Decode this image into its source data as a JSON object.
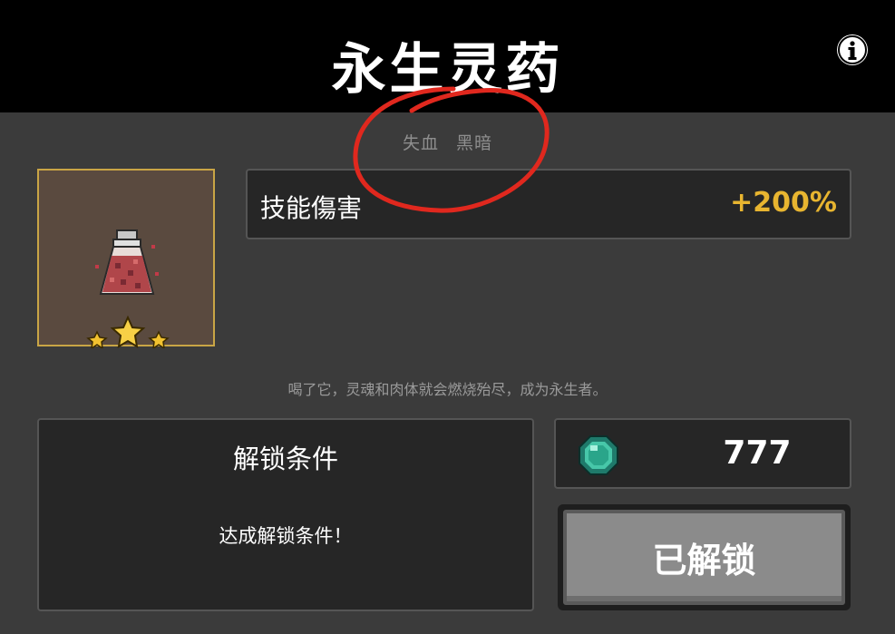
{
  "header": {
    "title": "永生灵药"
  },
  "tags": [
    "失血",
    "黑暗"
  ],
  "item": {
    "icon": "potion-bottle-icon",
    "stars": 3,
    "frame_color": "#c9a545"
  },
  "stat": {
    "name": "技能傷害",
    "value": "+200%",
    "value_color": "#e8b530"
  },
  "description": "喝了它，灵魂和肉体就会燃烧殆尽，成为永生者。",
  "unlock": {
    "title": "解锁条件",
    "text": "达成解锁条件！"
  },
  "cost": {
    "icon": "gem-icon",
    "value": "777"
  },
  "button": {
    "label": "已解锁"
  },
  "annotation": {
    "color": "#e0281e"
  }
}
